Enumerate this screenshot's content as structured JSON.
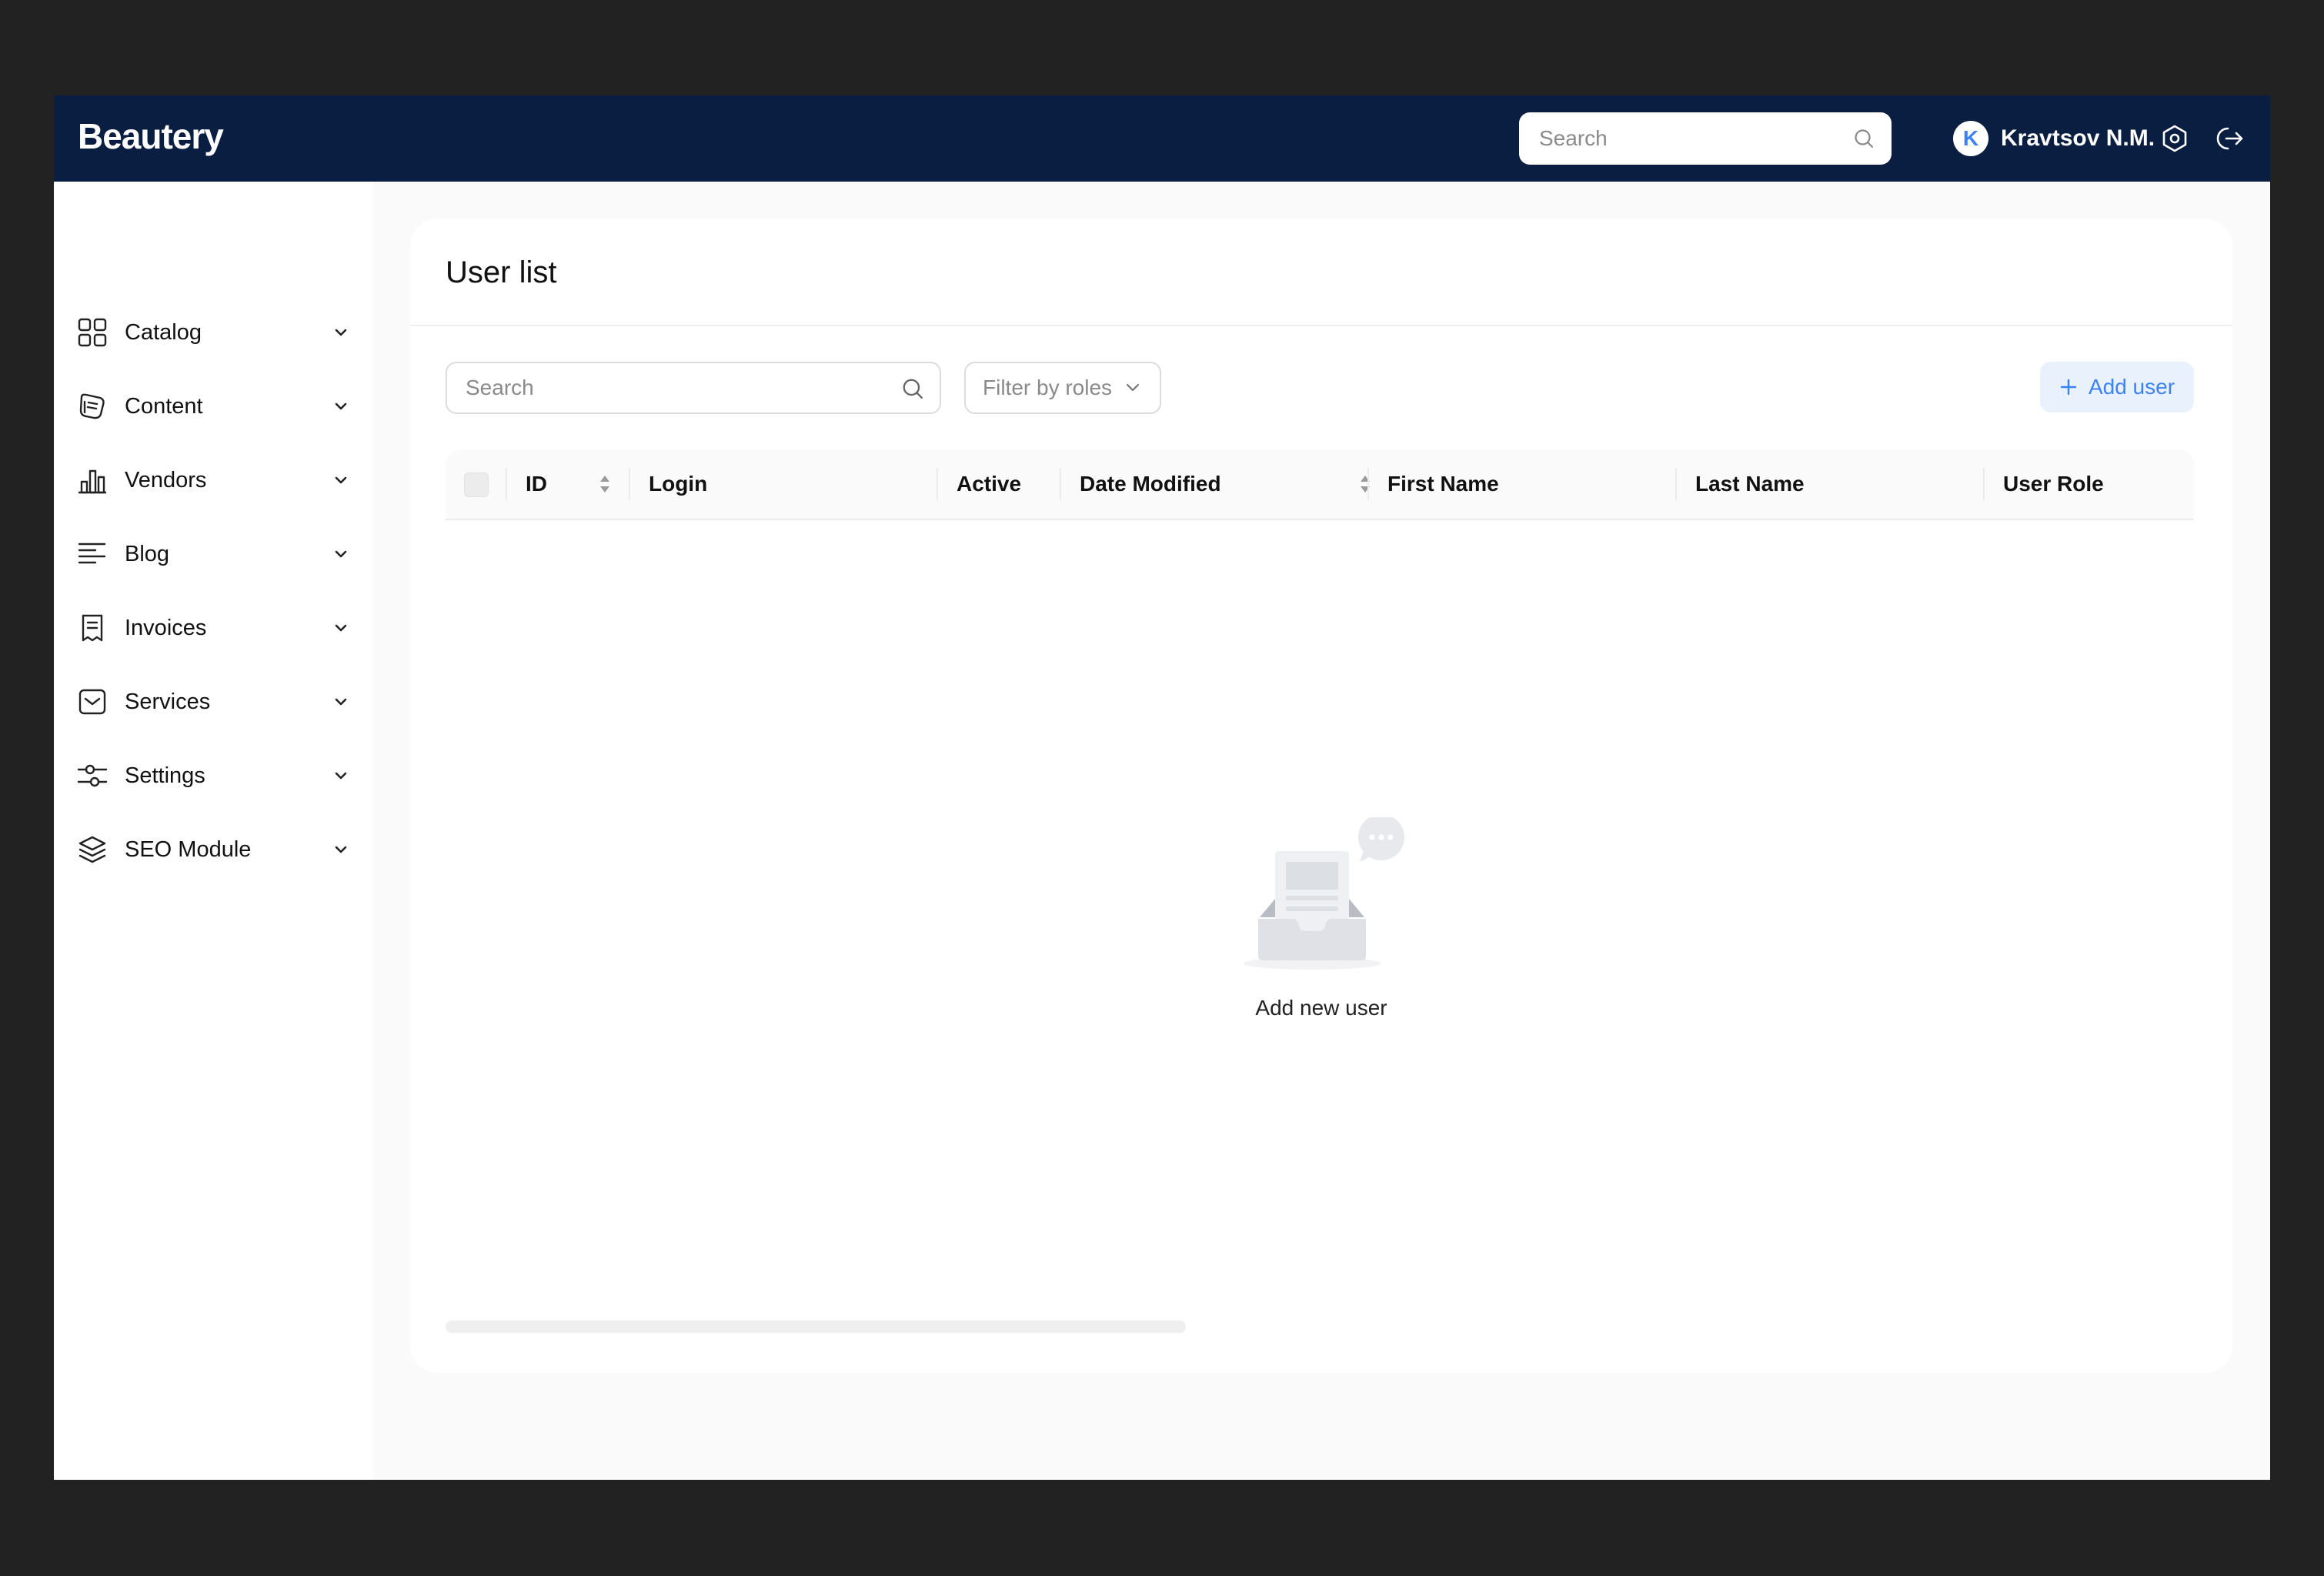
{
  "header": {
    "logo": "Beautery",
    "search_placeholder": "Search",
    "user": {
      "initial": "K",
      "name": "Kravtsov N.M."
    },
    "icons": [
      "search-icon",
      "settings-hex-icon",
      "logout-icon"
    ]
  },
  "sidebar": {
    "items": [
      {
        "label": "Catalog",
        "icon": "grid-icon"
      },
      {
        "label": "Content",
        "icon": "content-icon"
      },
      {
        "label": "Vendors",
        "icon": "bar-chart-icon"
      },
      {
        "label": "Blog",
        "icon": "text-lines-icon"
      },
      {
        "label": "Invoices",
        "icon": "receipt-icon"
      },
      {
        "label": "Services",
        "icon": "mail-box-icon"
      },
      {
        "label": "Settings",
        "icon": "sliders-icon"
      },
      {
        "label": "SEO Module",
        "icon": "layers-icon"
      }
    ]
  },
  "main": {
    "title": "User list",
    "search_placeholder": "Search",
    "filter_label": "Filter by roles",
    "add_button_label": "Add user",
    "table": {
      "columns": [
        "ID",
        "Login",
        "Active",
        "Date Modified",
        "First Name",
        "Last Name",
        "User Role"
      ],
      "rows": []
    },
    "empty_text": "Add new user"
  },
  "colors": {
    "header_bg": "#0a1e42",
    "accent": "#3b82f6",
    "accent_light": "#e8f1fc",
    "page_bg": "#fafafa"
  }
}
